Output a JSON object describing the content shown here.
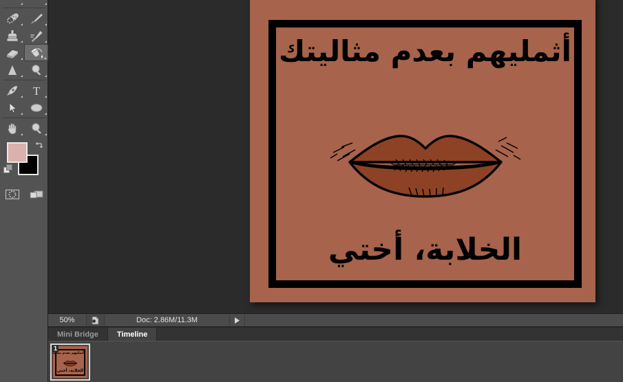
{
  "app": {
    "title": "Adobe Photoshop",
    "theme_bg": "#2b2b2b",
    "panel_bg": "#434343",
    "toolbar_bg": "#535353"
  },
  "toolbar": {
    "selected_tool": "paint-bucket",
    "tools": [
      {
        "name": "healing-brush",
        "label": "Spot Healing Brush Tool",
        "has_flyout": true
      },
      {
        "name": "brush",
        "label": "Brush Tool",
        "has_flyout": true
      },
      {
        "name": "clone-stamp",
        "label": "Clone Stamp Tool",
        "has_flyout": true
      },
      {
        "name": "history-brush",
        "label": "History Brush Tool",
        "has_flyout": true
      },
      {
        "name": "eraser",
        "label": "Eraser Tool",
        "has_flyout": true
      },
      {
        "name": "paint-bucket",
        "label": "Paint Bucket Tool",
        "has_flyout": true,
        "selected": true
      },
      {
        "name": "gradient-blur",
        "label": "Blur Tool",
        "has_flyout": true
      },
      {
        "name": "dodge",
        "label": "Dodge Tool",
        "has_flyout": true
      },
      {
        "name": "pen",
        "label": "Pen Tool",
        "has_flyout": true
      },
      {
        "name": "type",
        "label": "Horizontal Type Tool",
        "has_flyout": true
      },
      {
        "name": "path-selection",
        "label": "Path Selection Tool",
        "has_flyout": true
      },
      {
        "name": "ellipse",
        "label": "Ellipse Tool",
        "has_flyout": true
      },
      {
        "name": "hand",
        "label": "Hand Tool",
        "has_flyout": true
      },
      {
        "name": "zoom",
        "label": "Zoom Tool",
        "has_flyout": true
      }
    ],
    "colors": {
      "foreground": "#dcb0ab",
      "background": "#000000",
      "swap_label": "Switch Foreground and Background Colors",
      "default_label": "Default Foreground and Background Colors"
    },
    "modes": [
      {
        "name": "quick-mask",
        "label": "Edit in Quick Mask Mode"
      },
      {
        "name": "screen-mode",
        "label": "Change Screen Mode",
        "has_flyout": true
      }
    ]
  },
  "status_bar": {
    "zoom": "50%",
    "doc_icon": "document-icon",
    "doc_info": "Doc: 2.86M/11.3M",
    "play_icon": "play-arrow-icon"
  },
  "panel_tabs": [
    {
      "name": "mini-bridge",
      "label": "Mini Bridge",
      "active": false
    },
    {
      "name": "timeline",
      "label": "Timeline",
      "active": true
    }
  ],
  "timeline": {
    "frames": [
      {
        "number": "1",
        "selected": true
      }
    ]
  },
  "artwork": {
    "canvas_color": "#a7634b",
    "frame_color": "#000000",
    "lips_fill": "#8d4225",
    "lips_stroke": "#000000",
    "text_top": "أثمليهم بعدم مثاليتك",
    "text_bottom": "الخلابة، أختي"
  }
}
